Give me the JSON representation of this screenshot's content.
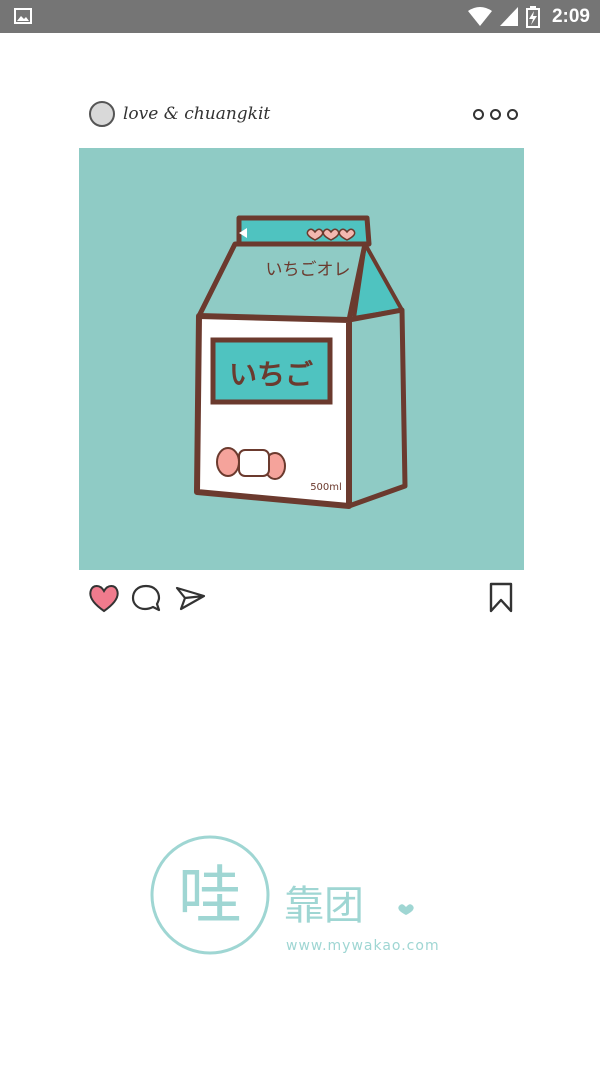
{
  "status_bar": {
    "time": "2:09",
    "icons": [
      "image-icon",
      "wifi-icon",
      "signal-icon",
      "battery-icon"
    ]
  },
  "post": {
    "username": "love & chuangkit",
    "image": {
      "description_icon": "strawberry-milk-carton-illustration",
      "carton_top_text": "いちごオレ",
      "carton_label": "いちご",
      "carton_volume": "500ml"
    },
    "actions": [
      "heart-icon",
      "comment-icon",
      "send-icon",
      "bookmark-icon"
    ],
    "liked": true
  },
  "watermark": {
    "logo_char": "哇",
    "brand_text": "靠团",
    "url": "www.mywakao.com"
  },
  "colors": {
    "status_bar_bg": "#757575",
    "image_bg": "#8fcbc5",
    "heart": "#f07b8d",
    "carton_teal": "#4fc3c0",
    "carton_outline": "#6b3a2e",
    "watermark": "#9fd6d3"
  }
}
